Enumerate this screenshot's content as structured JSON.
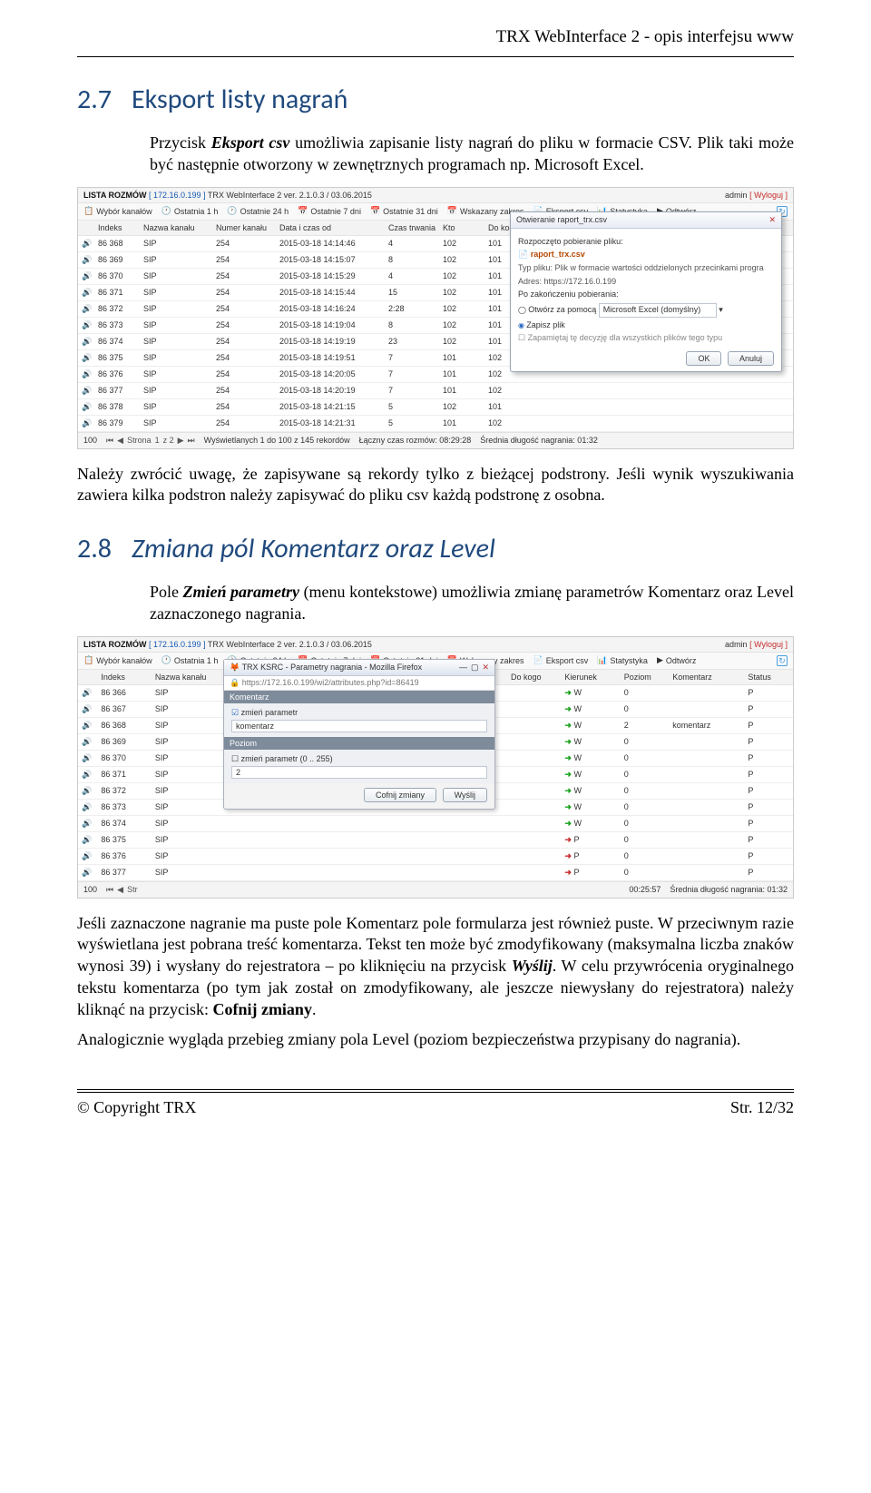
{
  "doc": {
    "header_title": "TRX WebInterface 2 - opis interfejsu www"
  },
  "sect27": {
    "num": "2.7",
    "title": "Eksport listy nagrań",
    "para1a": "Przycisk ",
    "para1b": "Eksport csv",
    "para1c": " umożliwia zapisanie listy nagrań do pliku w formacie CSV. Plik taki może być następnie otworzony w zewnętrznych programach np. Microsoft Excel.",
    "para2": "Należy zwrócić uwagę, że zapisywane są rekordy tylko z bieżącej podstrony. Jeśli wynik wyszukiwania zawiera kilka podstron należy zapisywać do pliku csv każdą podstronę z osobna."
  },
  "sect28": {
    "num": "2.8",
    "title": "Zmiana pól Komentarz oraz Level",
    "para1a": "Pole ",
    "para1b": "Zmień parametry",
    "para1c": " (menu kontekstowe) umożliwia zmianę parametrów Komentarz oraz Level zaznaczonego nagrania.",
    "para2a": "Jeśli zaznaczone nagranie ma puste pole Komentarz pole formularza jest również puste. W przeciwnym razie wyświetlana jest pobrana treść komentarza. Tekst ten może być zmodyfikowany (maksymalna liczba znaków wynosi 39) i wysłany do rejestratora – po kliknięciu na przycisk ",
    "para2b": "Wyślij",
    "para2c": ". W celu przywrócenia oryginalnego tekstu komentarza (po tym jak został on zmodyfikowany, ale jeszcze niewysłany do rejestratora) należy kliknąć na przycisk: ",
    "para2d": "Cofnij zmiany",
    "para2e": ".",
    "para3": "Analogicznie wygląda przebieg zmiany pola Level (poziom bezpieczeństwa przypisany do nagrania)."
  },
  "ss_common": {
    "list_label": "LISTA ROZMÓW",
    "ip": "[ 172.16.0.199 ]",
    "title": "TRX WebInterface 2 ver. 2.1.0.3 / 03.06.2015",
    "admin": "admin",
    "logout": "[ Wyloguj ]",
    "btn_channels": "Wybór kanałów",
    "btn_1h": "Ostatnia 1 h",
    "btn_24h": "Ostatnie 24 h",
    "btn_7d": "Ostatnie 7 dni",
    "btn_31d": "Ostatnie 31 dni",
    "btn_range": "Wskazany zakres",
    "btn_export": "Eksport csv",
    "btn_stats": "Statystyka",
    "btn_play": "Odtwórz",
    "col_index": "Indeks",
    "col_chname": "Nazwa kanału",
    "col_chnum": "Numer kanału",
    "col_datetime": "Data i czas od",
    "col_dur": "Czas trwania",
    "col_from": "Kto",
    "col_to": "Do kogo",
    "col_dir": "Kierunek",
    "col_level": "Poziom",
    "col_comment": "Komentarz",
    "col_status": "Status",
    "pager_100": "100",
    "pager_page": "Strona",
    "pager_1": "1",
    "pager_of": "z 2"
  },
  "ss1": {
    "rows": [
      {
        "idx": "86 368",
        "ch": "SIP",
        "num": "254",
        "dt": "2015-03-18 14:14:46",
        "dur": "4",
        "f": "102",
        "t": "101"
      },
      {
        "idx": "86 369",
        "ch": "SIP",
        "num": "254",
        "dt": "2015-03-18 14:15:07",
        "dur": "8",
        "f": "102",
        "t": "101"
      },
      {
        "idx": "86 370",
        "ch": "SIP",
        "num": "254",
        "dt": "2015-03-18 14:15:29",
        "dur": "4",
        "f": "102",
        "t": "101"
      },
      {
        "idx": "86 371",
        "ch": "SIP",
        "num": "254",
        "dt": "2015-03-18 14:15:44",
        "dur": "15",
        "f": "102",
        "t": "101"
      },
      {
        "idx": "86 372",
        "ch": "SIP",
        "num": "254",
        "dt": "2015-03-18 14:16:24",
        "dur": "2:28",
        "f": "102",
        "t": "101"
      },
      {
        "idx": "86 373",
        "ch": "SIP",
        "num": "254",
        "dt": "2015-03-18 14:19:04",
        "dur": "8",
        "f": "102",
        "t": "101"
      },
      {
        "idx": "86 374",
        "ch": "SIP",
        "num": "254",
        "dt": "2015-03-18 14:19:19",
        "dur": "23",
        "f": "102",
        "t": "101"
      },
      {
        "idx": "86 375",
        "ch": "SIP",
        "num": "254",
        "dt": "2015-03-18 14:19:51",
        "dur": "7",
        "f": "101",
        "t": "102"
      },
      {
        "idx": "86 376",
        "ch": "SIP",
        "num": "254",
        "dt": "2015-03-18 14:20:05",
        "dur": "7",
        "f": "101",
        "t": "102"
      },
      {
        "idx": "86 377",
        "ch": "SIP",
        "num": "254",
        "dt": "2015-03-18 14:20:19",
        "dur": "7",
        "f": "101",
        "t": "102"
      },
      {
        "idx": "86 378",
        "ch": "SIP",
        "num": "254",
        "dt": "2015-03-18 14:21:15",
        "dur": "5",
        "f": "102",
        "t": "101"
      },
      {
        "idx": "86 379",
        "ch": "SIP",
        "num": "254",
        "dt": "2015-03-18 14:21:31",
        "dur": "5",
        "f": "101",
        "t": "102"
      }
    ],
    "status_shown": "Wyświetlanych 1 do 100 z 145 rekordów",
    "status_total": "Łączny czas rozmów: 08:29:28",
    "status_avg": "Średnia długość nagrania: 01:32",
    "dlg": {
      "title": "Otwieranie raport_trx.csv",
      "started": "Rozpoczęto pobieranie pliku:",
      "file": "raport_trx.csv",
      "type": "Typ pliku: Plik w formacie wartości oddzielonych przecinkami progra",
      "addr": "Adres: https://172.16.0.199",
      "after": "Po zakończeniu pobierania:",
      "open": "Otwórz za pomocą",
      "open_val": "Microsoft Excel (domyślny)",
      "save": "Zapisz plik",
      "remember": "Zapamiętaj tę decyzję dla wszystkich plików tego typu",
      "ok": "OK",
      "cancel": "Anuluj"
    }
  },
  "ss2": {
    "rows": [
      {
        "idx": "86 366",
        "ch": "SIP",
        "dir": "W",
        "lvl": "0",
        "cm": "",
        "st": "P"
      },
      {
        "idx": "86 367",
        "ch": "SIP",
        "dir": "W",
        "lvl": "0",
        "cm": "",
        "st": "P"
      },
      {
        "idx": "86 368",
        "ch": "SIP",
        "dir": "W",
        "lvl": "2",
        "cm": "komentarz",
        "st": "P"
      },
      {
        "idx": "86 369",
        "ch": "SIP",
        "dir": "W",
        "lvl": "0",
        "cm": "",
        "st": "P"
      },
      {
        "idx": "86 370",
        "ch": "SIP",
        "dir": "W",
        "lvl": "0",
        "cm": "",
        "st": "P"
      },
      {
        "idx": "86 371",
        "ch": "SIP",
        "dir": "W",
        "lvl": "0",
        "cm": "",
        "st": "P"
      },
      {
        "idx": "86 372",
        "ch": "SIP",
        "dir": "W",
        "lvl": "0",
        "cm": "",
        "st": "P"
      },
      {
        "idx": "86 373",
        "ch": "SIP",
        "dir": "W",
        "lvl": "0",
        "cm": "",
        "st": "P"
      },
      {
        "idx": "86 374",
        "ch": "SIP",
        "dir": "W",
        "lvl": "0",
        "cm": "",
        "st": "P"
      },
      {
        "idx": "86 375",
        "ch": "SIP",
        "dir": "P",
        "lvl": "0",
        "cm": "",
        "st": "P"
      },
      {
        "idx": "86 376",
        "ch": "SIP",
        "dir": "P",
        "lvl": "0",
        "cm": "",
        "st": "P"
      },
      {
        "idx": "86 377",
        "ch": "SIP",
        "dir": "P",
        "lvl": "0",
        "cm": "",
        "st": "P"
      }
    ],
    "status_total": "00:25:57",
    "status_avg": "Średnia długość nagrania: 01:32",
    "dlg": {
      "title": "TRX KSRC - Parametry nagrania - Mozilla Firefox",
      "url": "https://172.16.0.199/wi2/attributes.php?id=86419",
      "sec_comment": "Komentarz",
      "chk1": "zmień parametr",
      "val1": "komentarz",
      "sec_level": "Poziom",
      "chk2": "zmień parametr (0 .. 255)",
      "val2": "2",
      "btn_undo": "Cofnij zmiany",
      "btn_send": "Wyślij"
    }
  },
  "footer": {
    "left": "© Copyright TRX",
    "right": "Str. 12/32"
  }
}
